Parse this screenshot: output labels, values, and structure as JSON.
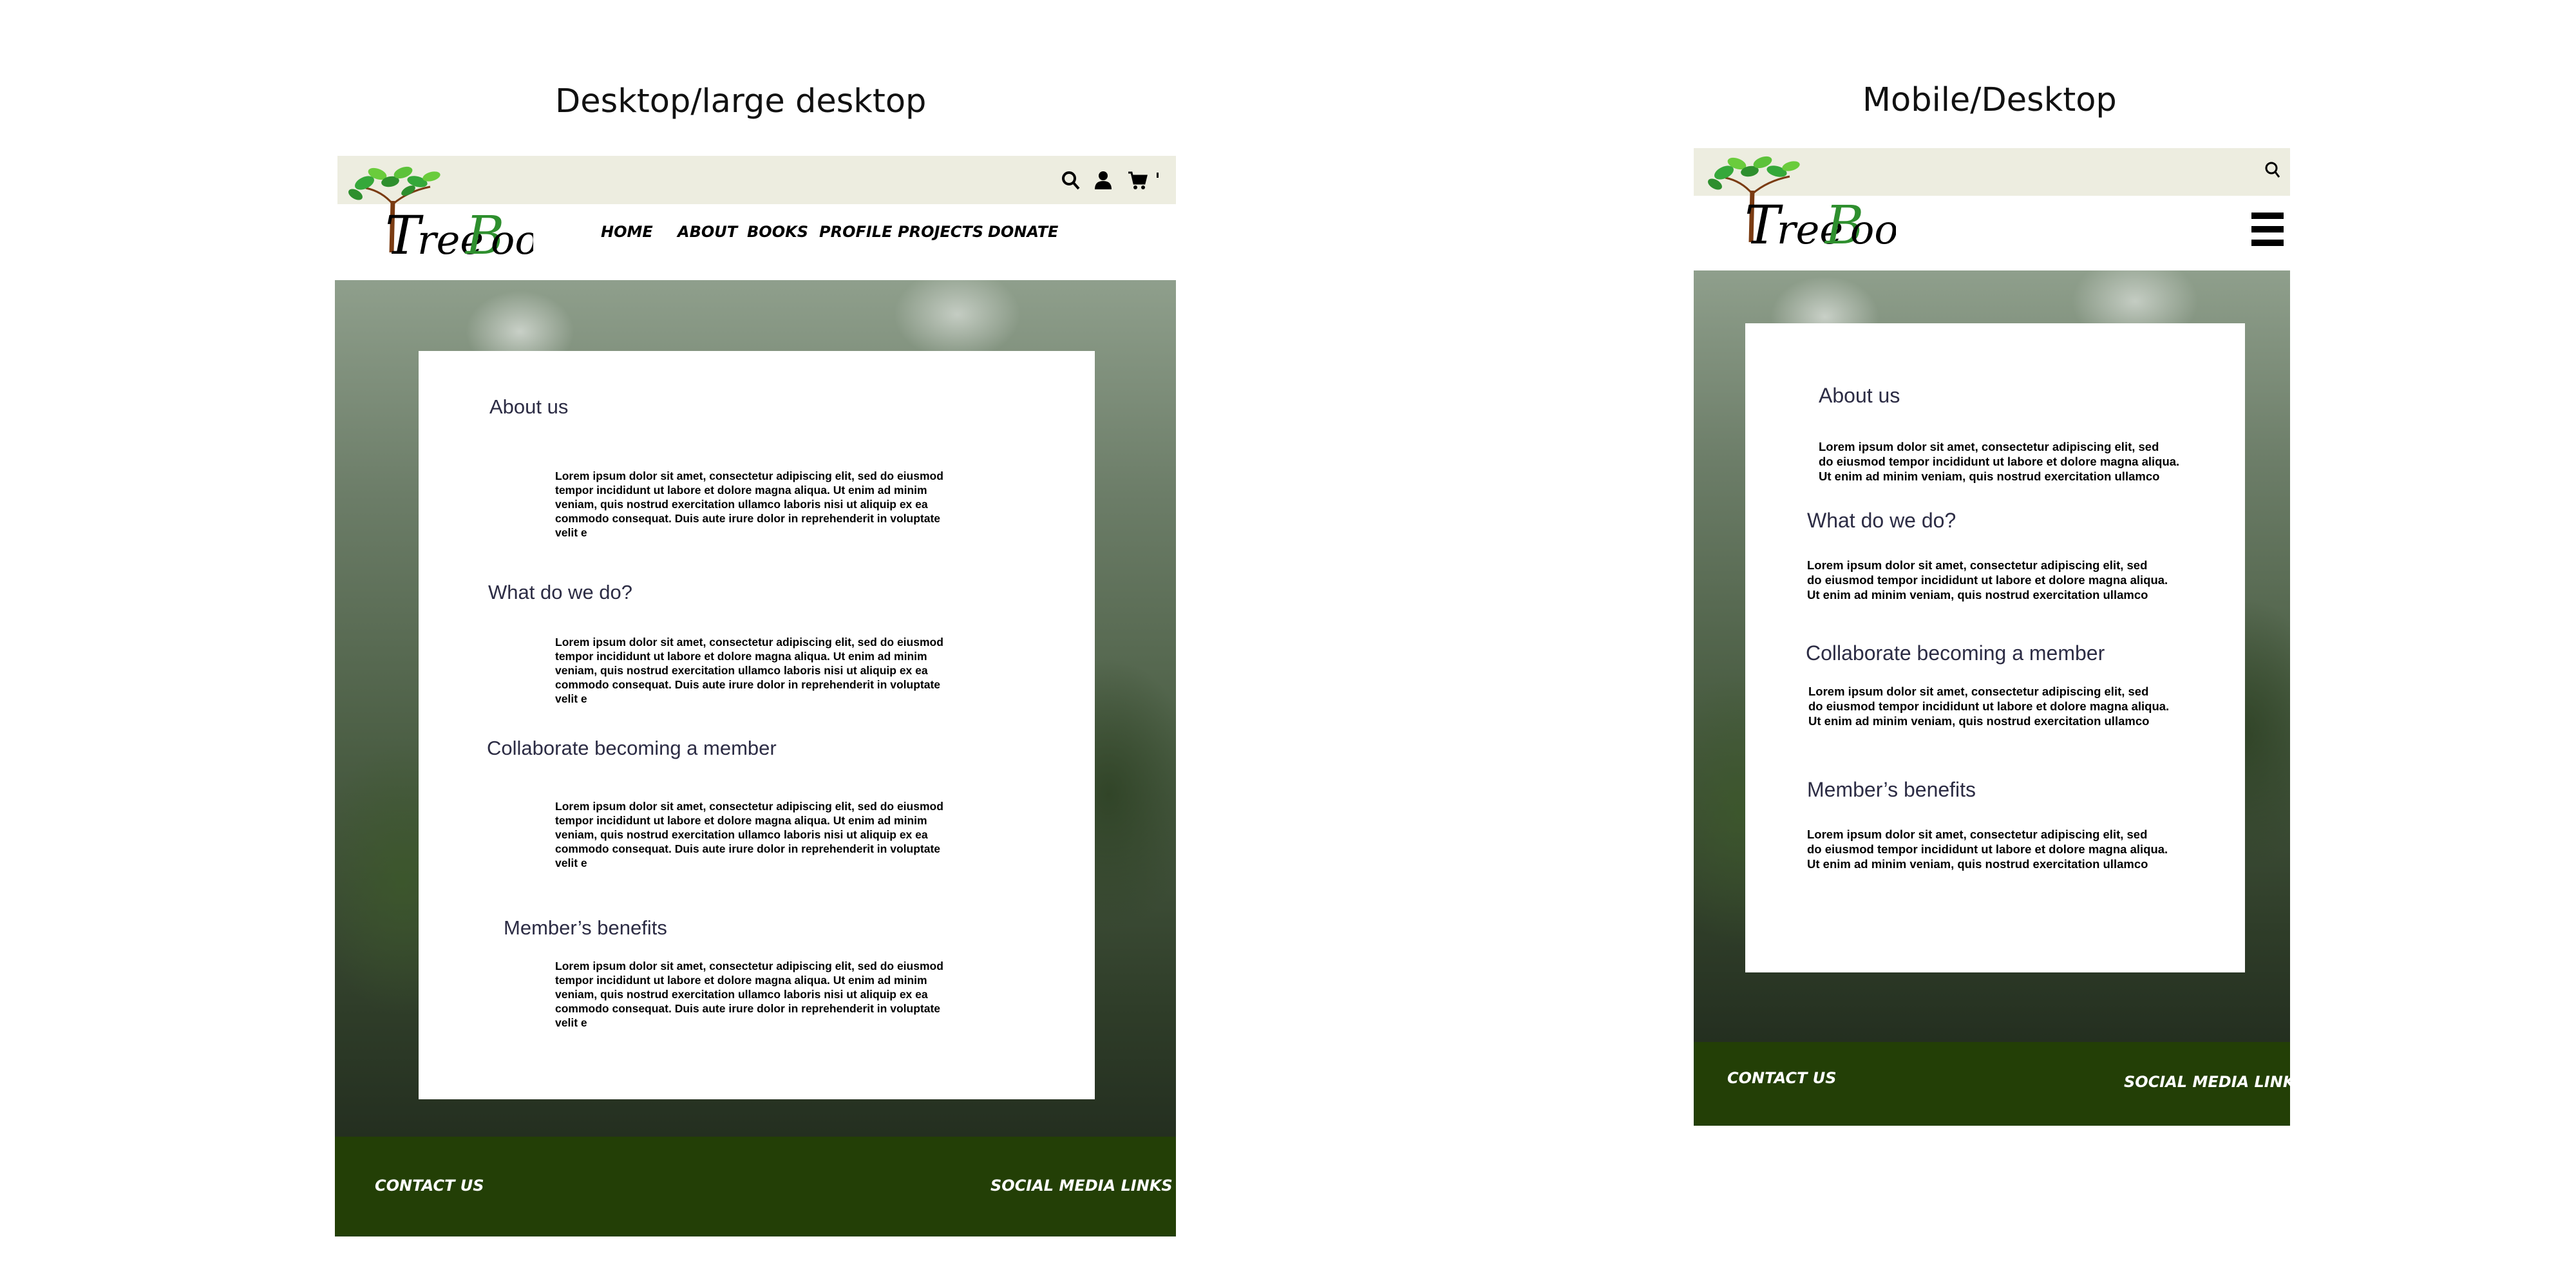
{
  "mockups": {
    "desktop_title": "Desktop/large desktop",
    "mobile_title": "Mobile/Desktop"
  },
  "brand": {
    "name": "TreeBooks"
  },
  "nav": {
    "items": [
      "HOME",
      "ABOUT",
      "BOOKS",
      "PROFILE",
      "PROJECTS",
      "DONATE"
    ]
  },
  "icons": [
    "search-icon",
    "user-icon",
    "cart-icon",
    "menu-icon"
  ],
  "colors": {
    "topbar": "#edede0",
    "footer": "#233f06",
    "heading": "#2c2c44"
  },
  "desktop": {
    "sections": [
      {
        "heading": "About us",
        "body": "Lorem ipsum dolor sit amet, consectetur adipiscing elit, sed do eiusmod\n tempor incididunt ut labore et dolore magna aliqua. Ut enim ad minim\nveniam, quis nostrud exercitation ullamco laboris nisi ut aliquip ex ea\ncommodo consequat. Duis aute irure dolor in reprehenderit in voluptate\nvelit e"
      },
      {
        "heading": "What do we do?",
        "body": "Lorem ipsum dolor sit amet, consectetur adipiscing elit, sed do eiusmod\n tempor incididunt ut labore et dolore magna aliqua. Ut enim ad minim\nveniam, quis nostrud exercitation ullamco laboris nisi ut aliquip ex ea\ncommodo consequat. Duis aute irure dolor in reprehenderit in voluptate\nvelit e"
      },
      {
        "heading": "Collaborate becoming a member",
        "body": "Lorem ipsum dolor sit amet, consectetur adipiscing elit, sed do eiusmod\n tempor incididunt ut labore et dolore magna aliqua. Ut enim ad minim\nveniam, quis nostrud exercitation ullamco laboris nisi ut aliquip ex ea\ncommodo consequat. Duis aute irure dolor in reprehenderit in voluptate\nvelit e"
      },
      {
        "heading": "Member’s benefits",
        "body": "Lorem ipsum dolor sit amet, consectetur adipiscing elit, sed do eiusmod\n tempor incididunt ut labore et dolore magna aliqua. Ut enim ad minim\nveniam, quis nostrud exercitation ullamco laboris nisi ut aliquip ex ea\ncommodo consequat. Duis aute irure dolor in reprehenderit in voluptate\nvelit e"
      }
    ]
  },
  "mobile": {
    "sections": [
      {
        "heading": "About us",
        "body": "Lorem ipsum dolor sit amet, consectetur adipiscing elit, sed\n do eiusmod tempor incididunt ut labore et dolore magna aliqua.\nUt enim ad minim veniam, quis nostrud exercitation ullamco"
      },
      {
        "heading": "What do we do?",
        "body": "Lorem ipsum dolor sit amet, consectetur adipiscing elit, sed\n do eiusmod tempor incididunt ut labore et dolore magna aliqua.\nUt enim ad minim veniam, quis nostrud exercitation ullamco"
      },
      {
        "heading": "Collaborate becoming a member",
        "body": "Lorem ipsum dolor sit amet, consectetur adipiscing elit, sed\n do eiusmod tempor incididunt ut labore et dolore magna aliqua.\nUt enim ad minim veniam, quis nostrud exercitation ullamco"
      },
      {
        "heading": "Member’s benefits",
        "body": "Lorem ipsum dolor sit amet, consectetur adipiscing elit, sed\n do eiusmod tempor incididunt ut labore et dolore magna aliqua.\nUt enim ad minim veniam, quis nostrud exercitation ullamco"
      }
    ]
  },
  "footer": {
    "contact": "CONTACT US",
    "social": "SOCIAL MEDIA LINKS"
  }
}
